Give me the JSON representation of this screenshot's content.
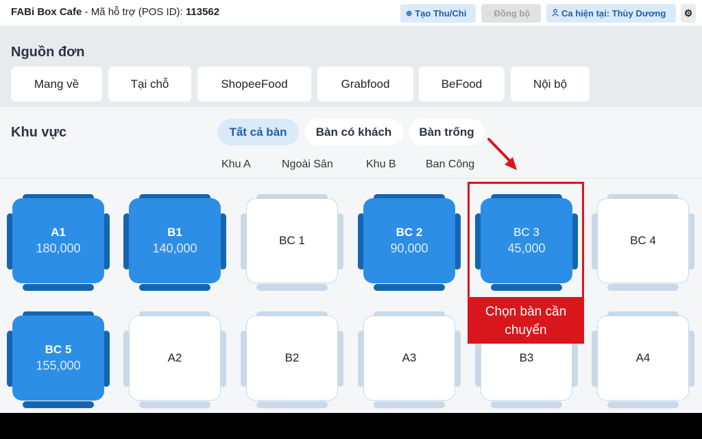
{
  "topbar": {
    "brand_name": "FABi Box Cafe",
    "support_label": " - Mã hỗ trợ (POS ID): ",
    "pos_id": "113562",
    "create_icon": "plus-circle-icon",
    "create_label": "Tạo Thu/Chi",
    "sync_icon": "sync-icon",
    "sync_label": "Đồng bộ",
    "shift_icon": "user-icon",
    "shift_label": "Ca hiện tại: Thùy Dương",
    "settings_icon": "gear-icon"
  },
  "source": {
    "title": "Nguồn đơn",
    "items": [
      "Mang về",
      "Tại chỗ",
      "ShopeeFood",
      "Grabfood",
      "BeFood",
      "Nội bộ"
    ]
  },
  "area": {
    "title": "Khu vực",
    "filters": [
      {
        "label": "Tất cả bàn",
        "active": true
      },
      {
        "label": "Bàn có khách",
        "active": false
      },
      {
        "label": "Bàn trống",
        "active": false
      }
    ],
    "zones": [
      "Khu A",
      "Ngoài Sân",
      "Khu B",
      "Ban Công"
    ]
  },
  "tables": [
    {
      "name": "A1",
      "amount": "180,000",
      "status": "busy"
    },
    {
      "name": "B1",
      "amount": "140,000",
      "status": "busy"
    },
    {
      "name": "BC 1",
      "amount": "",
      "status": "free"
    },
    {
      "name": "BC 2",
      "amount": "90,000",
      "status": "busy"
    },
    {
      "name": "BC 3",
      "amount": "45,000",
      "status": "busy",
      "selected": true
    },
    {
      "name": "BC 4",
      "amount": "",
      "status": "free"
    },
    {
      "name": "BC 5",
      "amount": "155,000",
      "status": "busy"
    },
    {
      "name": "A2",
      "amount": "",
      "status": "free"
    },
    {
      "name": "B2",
      "amount": "",
      "status": "free"
    },
    {
      "name": "A3",
      "amount": "",
      "status": "free"
    },
    {
      "name": "B3",
      "amount": "",
      "status": "free"
    },
    {
      "name": "A4",
      "amount": "",
      "status": "free"
    }
  ],
  "annotation": {
    "callout_line1": "Chọn bàn cần",
    "callout_line2": "chuyển",
    "color": "#d9161b"
  },
  "colors": {
    "accent": "#1f5fa8",
    "table_busy": "#2d8ee6",
    "table_busy_dark": "#1565b3",
    "table_free_edge": "#c9d9e8"
  }
}
